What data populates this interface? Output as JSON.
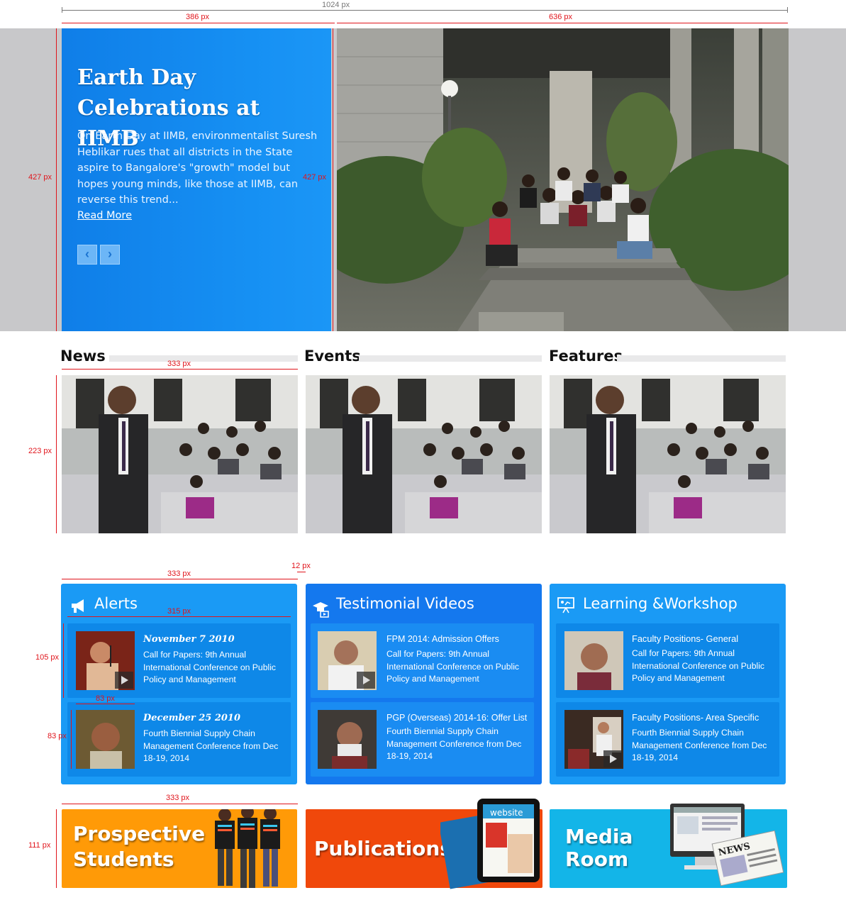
{
  "dimensions": {
    "total_width": "1024 px",
    "left_width": "386 px",
    "right_width": "636 px",
    "hero_height_left": "427 px",
    "hero_height_right": "427 px",
    "thumb_width": "333 px",
    "thumb_height": "223 px",
    "card_width": "333 px",
    "gutter": "12 px",
    "item_width": "315 px",
    "item_height": "105 px",
    "pic_width": "83 px",
    "pic_height": "83 px",
    "banner_width": "333 px",
    "banner_height": "111 px"
  },
  "hero": {
    "title": "Earth Day Celebrations at IIMB",
    "text": "On Earth Day at IIMB, environmentalist Suresh Heblikar rues that all districts in the State aspire to Bangalore's \"growth\" model but hopes young minds, like those at IIMB, can reverse this trend...",
    "link": "Read More",
    "prev_icon": "chevron-left-icon",
    "next_icon": "chevron-right-icon",
    "prev": "‹",
    "next": "›"
  },
  "sections": {
    "news": "News",
    "events": "Events",
    "features": "Features"
  },
  "alerts": {
    "title": "Alerts",
    "icon": "megaphone-icon",
    "items": [
      {
        "date": "November 7 2010",
        "desc": "Call for Papers: 9th Annual International Conference on Public Policy and Management"
      },
      {
        "date": "December 25 2010",
        "desc": "Fourth Biennial Supply Chain Management Conference from Dec 18-19, 2014"
      }
    ]
  },
  "videos": {
    "title": "Testimonial Videos",
    "icon": "graduation-video-icon",
    "items": [
      {
        "head": "FPM 2014: Admission Offers",
        "desc": "Call for Papers: 9th Annual International Conference on Public Policy and Management"
      },
      {
        "head": "PGP (Overseas) 2014-16: Offer List",
        "desc": "Fourth Biennial Supply Chain Management Conference from Dec 18-19, 2014"
      }
    ]
  },
  "workshop": {
    "title": "Learning &Workshop",
    "icon": "presentation-icon",
    "items": [
      {
        "head": "Faculty Positions- General",
        "desc": "Call for Papers: 9th Annual International Conference on Public Policy and Management"
      },
      {
        "head": "Faculty Positions- Area Specific",
        "desc": "Fourth Biennial Supply Chain Management Conference from Dec 18-19, 2014"
      }
    ]
  },
  "banners": {
    "prospective": "Prospective Students",
    "publications": "Publications",
    "media": "Media Room",
    "news_label": "NEWS",
    "website_label": "website"
  },
  "colors": {
    "hero_blue": "#1690f3",
    "card_blue": "#1a9af5",
    "card_blue_dark": "#1478ee",
    "orange": "#ff9a07",
    "red_orange": "#f0480b",
    "cyan": "#13b5e8",
    "annotation_red": "#e0141b"
  }
}
